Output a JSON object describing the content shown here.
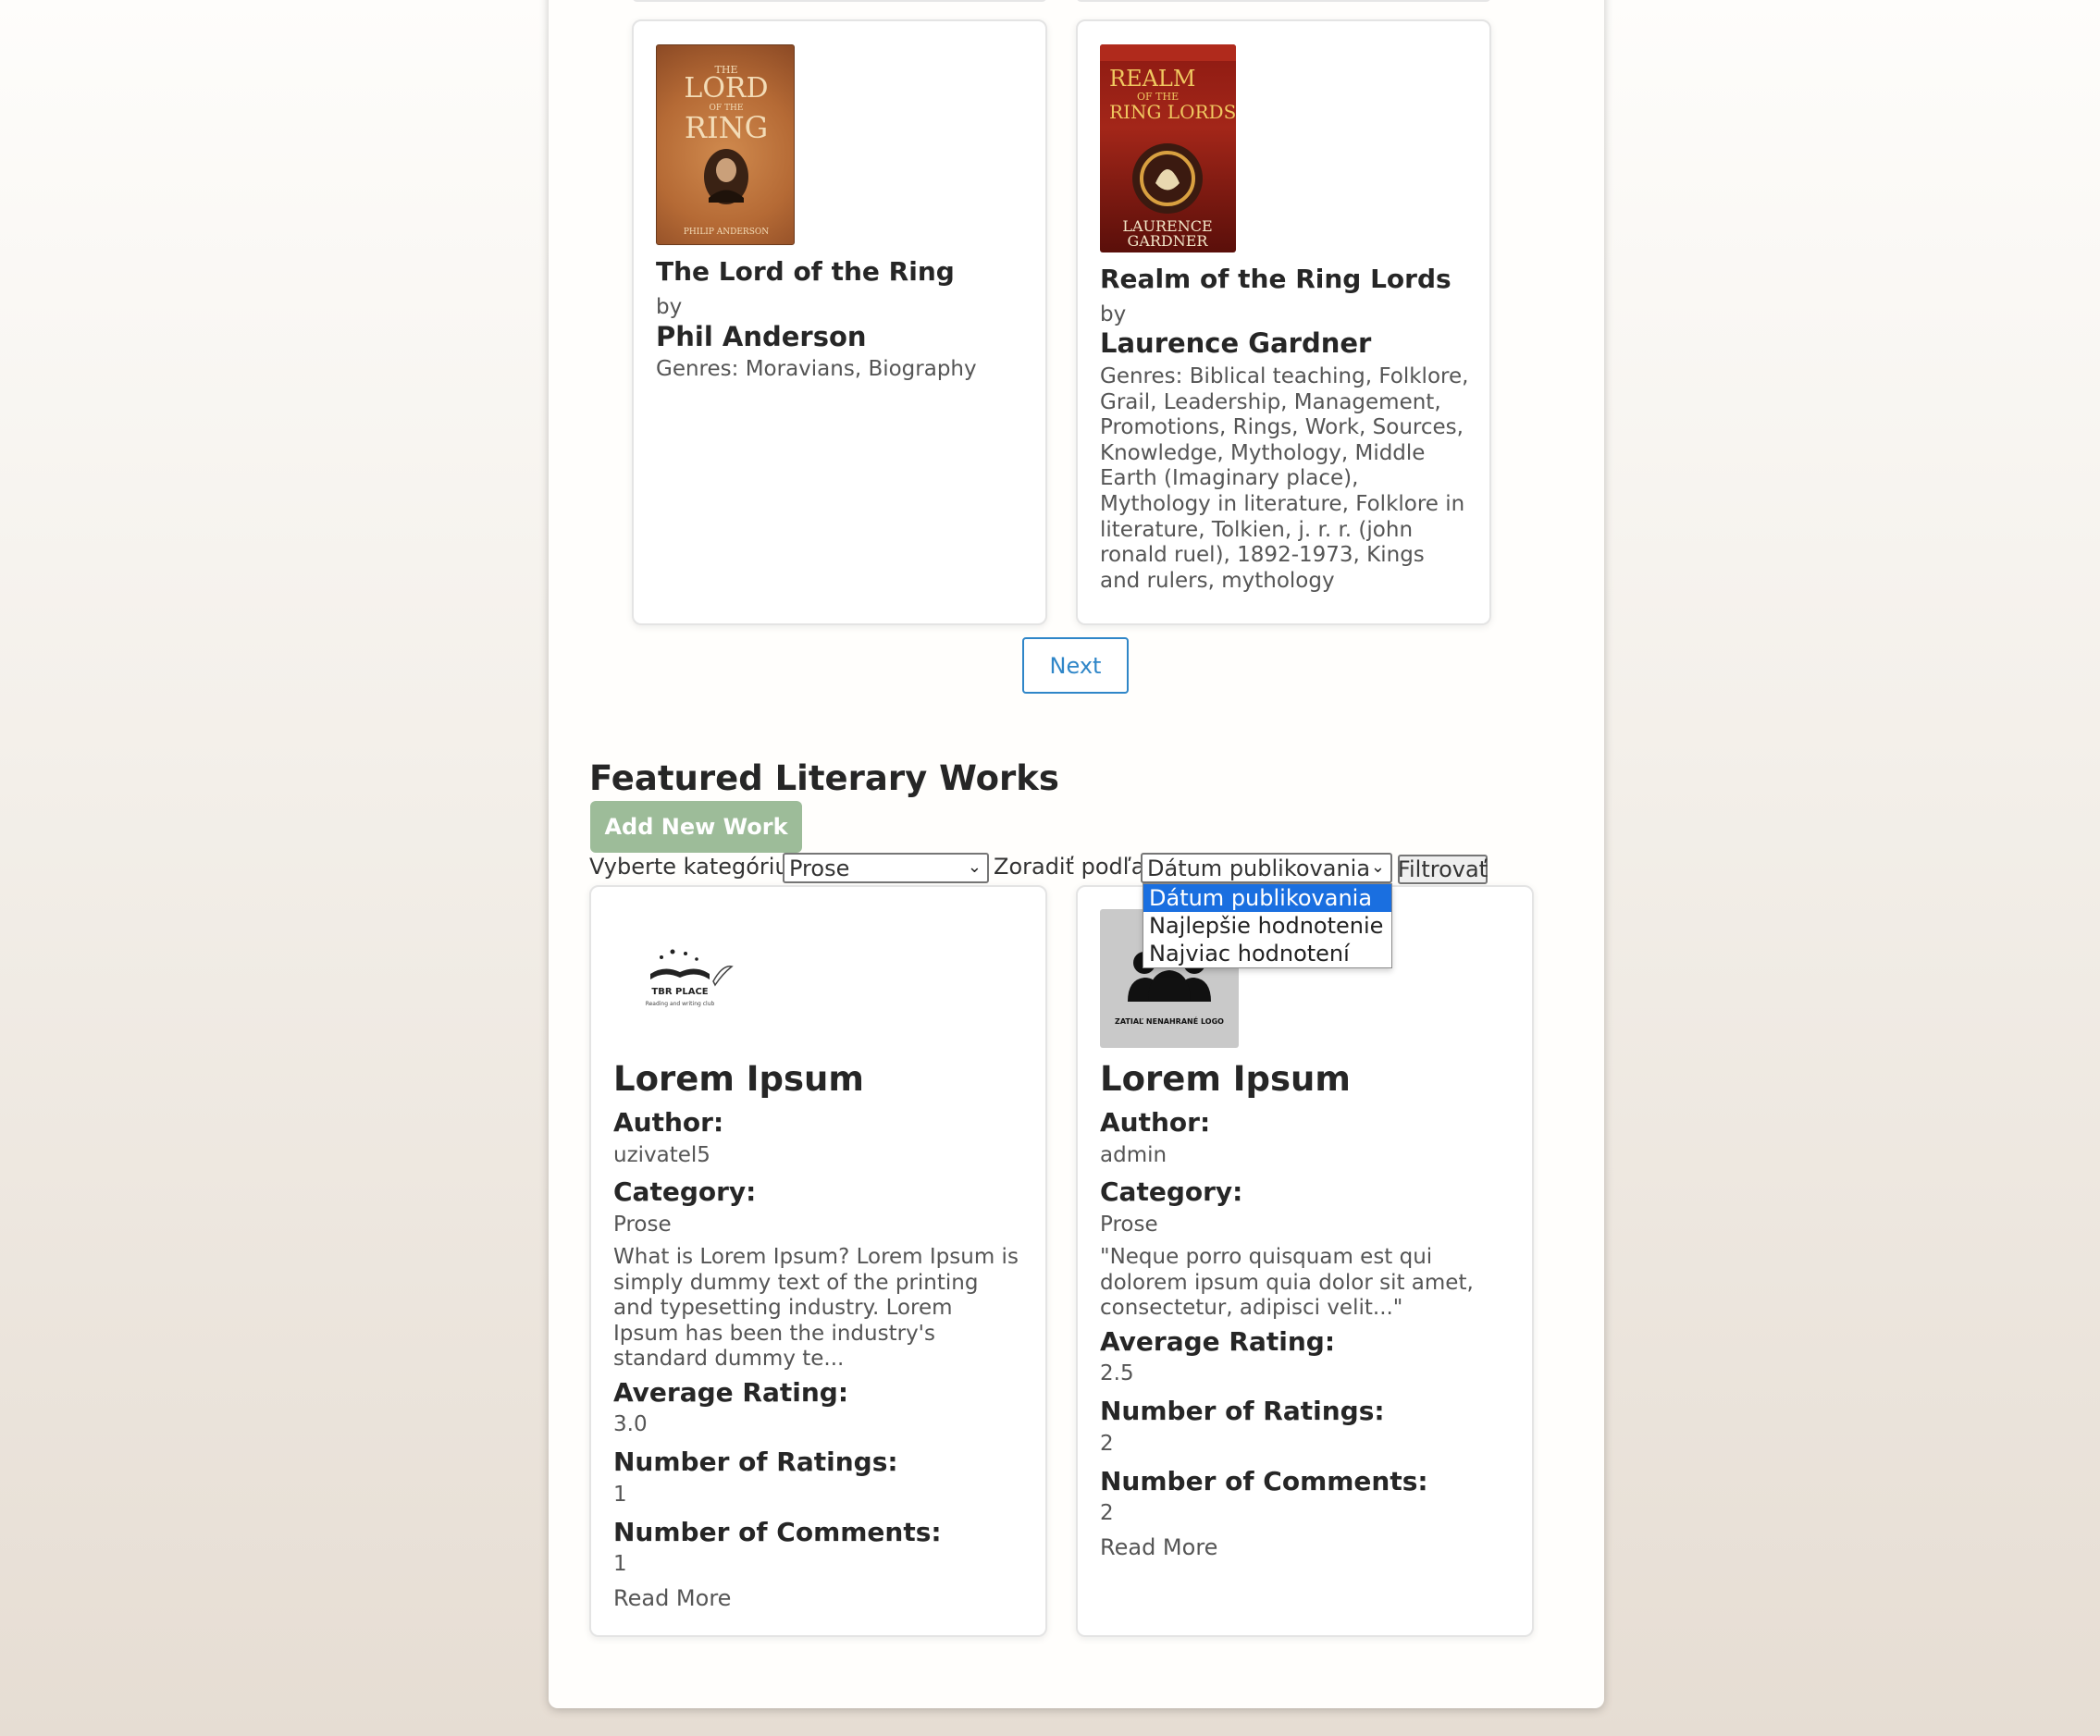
{
  "books": [
    {
      "title": "The Lord of the Ring",
      "by": "by",
      "author": "Phil Anderson",
      "genres": "Genres: Moravians, Biography",
      "cover": {
        "line1": "THE",
        "line2": "LORD",
        "line3": "OF THE",
        "line4": "RING",
        "footer": "PHILIP ANDERSON"
      }
    },
    {
      "title": "Realm of the Ring Lords",
      "by": "by",
      "author": "Laurence Gardner",
      "genres": "Genres: Biblical teaching, Folklore, Grail, Leadership, Management, Promotions, Rings, Work, Sources, Knowledge, Mythology, Middle Earth (Imaginary place), Mythology in literature, Folklore in literature, Tolkien, j. r. r. (john ronald ruel), 1892-1973, Kings and rulers, mythology",
      "cover": {
        "line1": "REALM",
        "line2": "OF THE",
        "line3": "RING LORDS",
        "footer1": "LAURENCE",
        "footer2": "GARDNER"
      }
    }
  ],
  "pagination": {
    "next_label": "Next"
  },
  "featured": {
    "title": "Featured Literary Works",
    "add_label": "Add New Work",
    "category_label": "Vyberte kategóriu:",
    "category_value": "Prose",
    "sort_label": "Zoradiť podľa:",
    "sort_value": "Dátum publikovania",
    "filter_label": "Filtrovať",
    "sort_options": [
      "Dátum publikovania",
      "Najlepšie hodnotenie",
      "Najviac hodnotení"
    ]
  },
  "works": [
    {
      "logo_text": "TBR PLACE",
      "logo_subtext": "Reading and writing club",
      "title": "Lorem Ipsum",
      "author_label": "Author:",
      "author": "uzivatel5",
      "category_label": "Category:",
      "category": "Prose",
      "description": "What is Lorem Ipsum? Lorem Ipsum is simply dummy text of the printing and typesetting industry. Lorem Ipsum has been the industry's standard dummy te...",
      "rating_label": "Average Rating:",
      "rating": "3.0",
      "num_ratings_label": "Number of Ratings:",
      "num_ratings": "1",
      "num_comments_label": "Number of Comments:",
      "num_comments": "1",
      "read_more": "Read More"
    },
    {
      "logo_text": "ZATIAĽ NENAHRANÉ LOGO",
      "title": "Lorem Ipsum",
      "author_label": "Author:",
      "author": "admin",
      "category_label": "Category:",
      "category": "Prose",
      "description": "\"Neque porro quisquam est qui dolorem ipsum quia dolor sit amet, consectetur, adipisci velit...\"",
      "rating_label": "Average Rating:",
      "rating": "2.5",
      "num_ratings_label": "Number of Ratings:",
      "num_ratings": "2",
      "num_comments_label": "Number of Comments:",
      "num_comments": "2",
      "read_more": "Read More"
    }
  ],
  "colors": {
    "accent_blue": "#2f86c8",
    "add_button": "#9dbc99",
    "dropdown_highlight": "#1a6fe0"
  }
}
